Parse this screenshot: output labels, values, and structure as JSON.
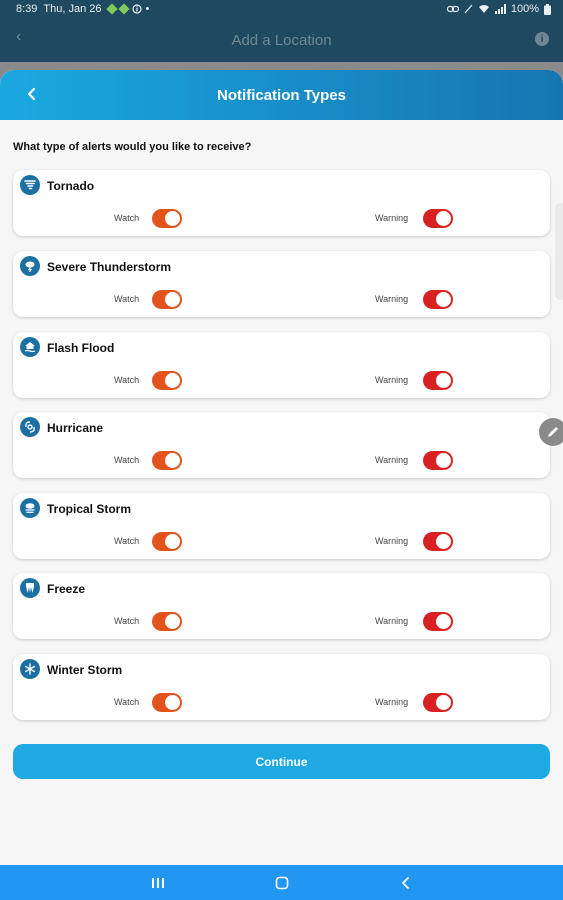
{
  "status": {
    "time": "8:39",
    "date": "Thu, Jan 26",
    "battery": "100%"
  },
  "background": {
    "title": "Add a Location"
  },
  "sheet": {
    "title": "Notification Types",
    "question": "What type of alerts would you like to receive?"
  },
  "colors": {
    "header_start": "#1aa8e0",
    "header_end": "#1776b2",
    "watch_toggle": "#e2541c",
    "warning_toggle": "#d92121",
    "button": "#1ea9e2",
    "nav_bar": "#2196f3",
    "icon_bg": "#1b6fa3"
  },
  "alerts": [
    {
      "name": "Tornado",
      "icon": "tornado-icon",
      "watch_label": "Watch",
      "warning_label": "Warning",
      "watch_on": true,
      "warning_on": true
    },
    {
      "name": "Severe Thunderstorm",
      "icon": "thunderstorm-icon",
      "watch_label": "Watch",
      "warning_label": "Warning",
      "watch_on": true,
      "warning_on": true
    },
    {
      "name": "Flash Flood",
      "icon": "flood-icon",
      "watch_label": "Watch",
      "warning_label": "Warning",
      "watch_on": true,
      "warning_on": true
    },
    {
      "name": "Hurricane",
      "icon": "hurricane-icon",
      "watch_label": "Watch",
      "warning_label": "Warning",
      "watch_on": true,
      "warning_on": true
    },
    {
      "name": "Tropical Storm",
      "icon": "tropical-storm-icon",
      "watch_label": "Watch",
      "warning_label": "Warning",
      "watch_on": true,
      "warning_on": true
    },
    {
      "name": "Freeze",
      "icon": "freeze-icon",
      "watch_label": "Watch",
      "warning_label": "Warning",
      "watch_on": true,
      "warning_on": true
    },
    {
      "name": "Winter Storm",
      "icon": "snowflake-icon",
      "watch_label": "Watch",
      "warning_label": "Warning",
      "watch_on": true,
      "warning_on": true
    }
  ],
  "continue_label": "Continue"
}
